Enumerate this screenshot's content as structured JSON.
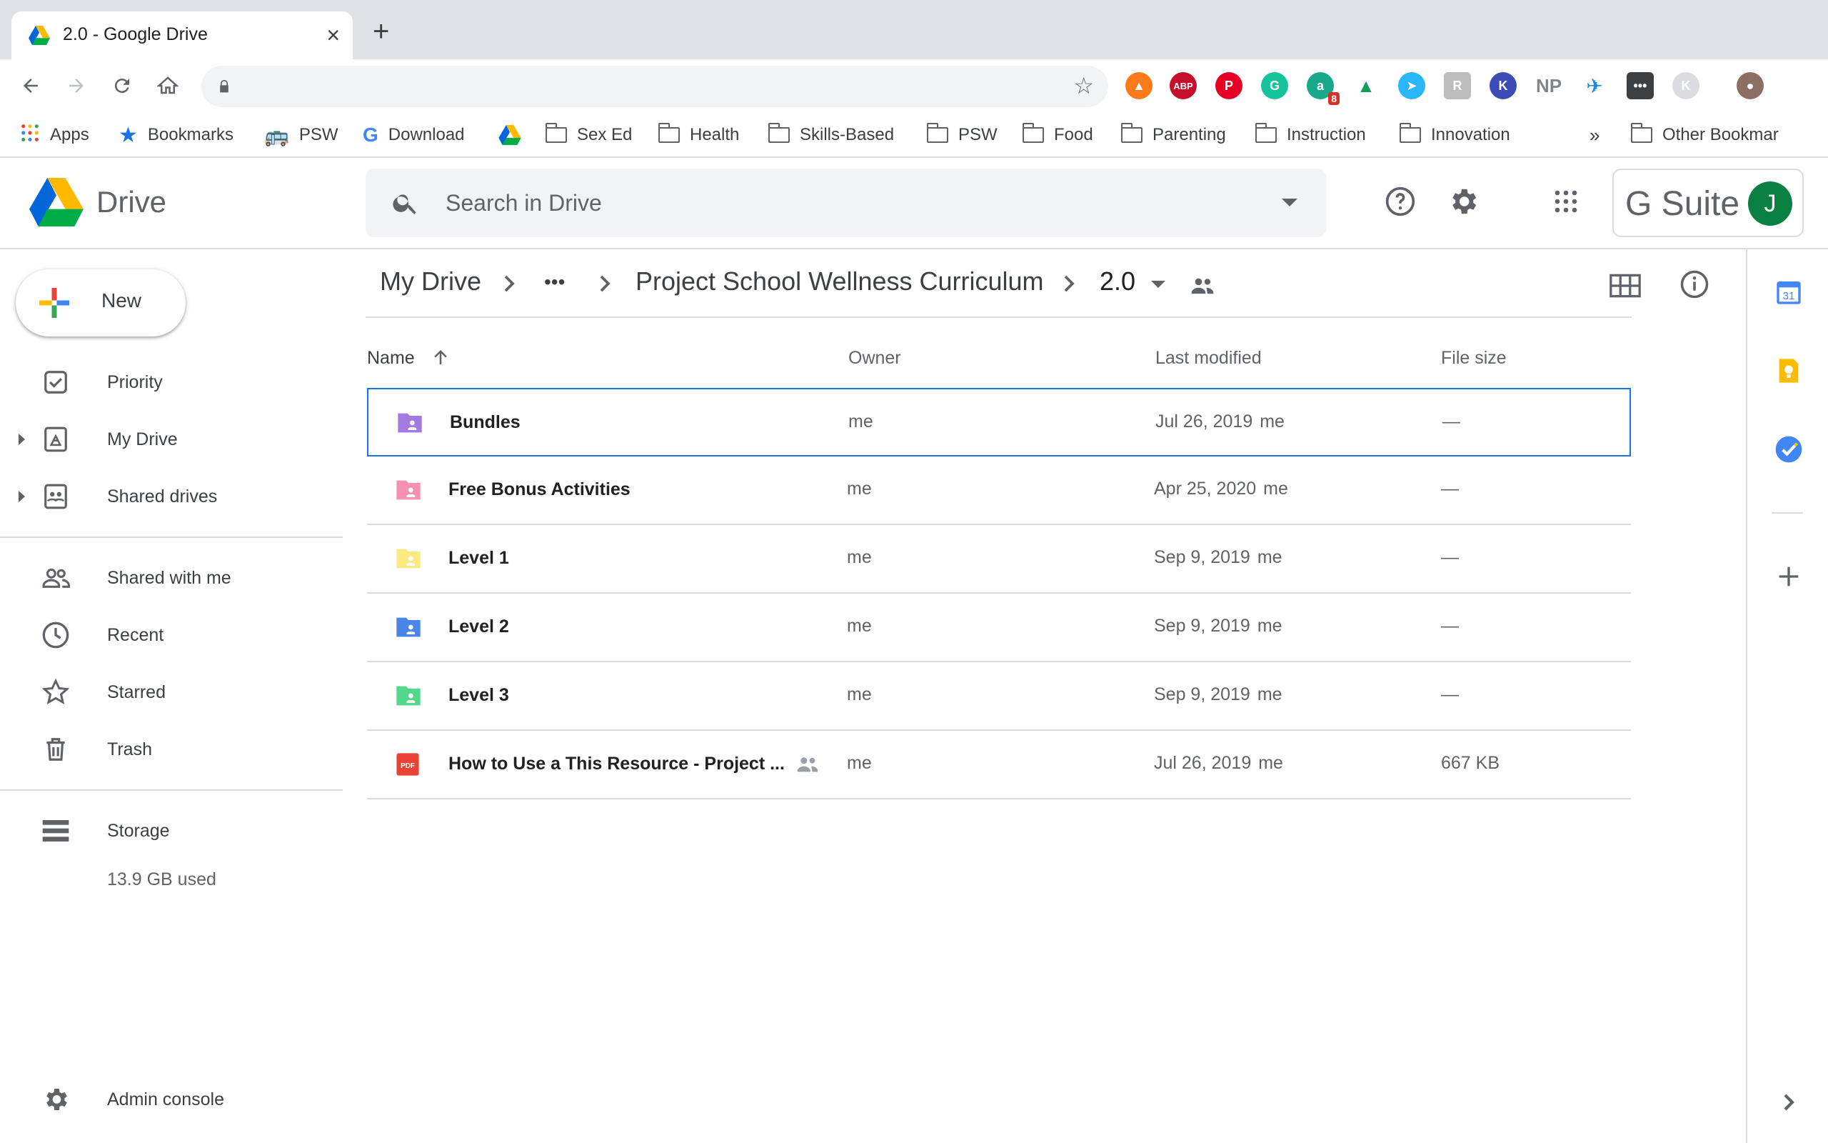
{
  "browser": {
    "tab_title": "2.0 - Google Drive",
    "close_glyph": "×",
    "new_tab_glyph": "+",
    "url": "",
    "extension_badge": "8",
    "extension_np": "NP"
  },
  "bookmarks": {
    "apps": "Apps",
    "items": [
      "Bookmarks",
      "PSW",
      "Download",
      "Sex Ed",
      "Health",
      "Skills-Based",
      "PSW",
      "Food",
      "Parenting",
      "Instruction",
      "Innovation"
    ],
    "overflow": "»",
    "other": "Other Bookmar"
  },
  "header": {
    "app_name": "Drive",
    "search_placeholder": "Search in Drive",
    "gsuite_label": "G Suite",
    "avatar_letter": "J"
  },
  "sidebar": {
    "new_label": "New",
    "items": [
      {
        "label": "Priority",
        "icon": "priority-icon"
      },
      {
        "label": "My Drive",
        "icon": "my-drive-icon"
      },
      {
        "label": "Shared drives",
        "icon": "shared-drives-icon"
      },
      {
        "label": "Shared with me",
        "icon": "people-icon"
      },
      {
        "label": "Recent",
        "icon": "clock-icon"
      },
      {
        "label": "Starred",
        "icon": "star-icon"
      },
      {
        "label": "Trash",
        "icon": "trash-icon"
      }
    ],
    "storage_label": "Storage",
    "storage_used": "13.9 GB used",
    "admin_label": "Admin console"
  },
  "breadcrumb": {
    "root": "My Drive",
    "ellipsis": "•••",
    "parent": "Project School Wellness Curriculum",
    "current": "2.0"
  },
  "columns": {
    "name": "Name",
    "owner": "Owner",
    "modified": "Last modified",
    "size": "File size"
  },
  "files": [
    {
      "name": "Bundles",
      "type": "shared-folder",
      "color": "#a479e2",
      "owner": "me",
      "modified": "Jul 26, 2019",
      "modified_by": "me",
      "size": "—",
      "selected": true
    },
    {
      "name": "Free Bonus Activities",
      "type": "shared-folder",
      "color": "#f691b3",
      "owner": "me",
      "modified": "Apr 25, 2020",
      "modified_by": "me",
      "size": "—"
    },
    {
      "name": "Level 1",
      "type": "shared-folder",
      "color": "#fbe983",
      "owner": "me",
      "modified": "Sep 9, 2019",
      "modified_by": "me",
      "size": "—"
    },
    {
      "name": "Level 2",
      "type": "shared-folder",
      "color": "#4986e7",
      "owner": "me",
      "modified": "Sep 9, 2019",
      "modified_by": "me",
      "size": "—"
    },
    {
      "name": "Level 3",
      "type": "shared-folder",
      "color": "#51d88a",
      "owner": "me",
      "modified": "Sep 9, 2019",
      "modified_by": "me",
      "size": "—"
    },
    {
      "name": "How to Use a This Resource - Project ...",
      "type": "pdf",
      "color": "#ea4335",
      "owner": "me",
      "modified": "Jul 26, 2019",
      "modified_by": "me",
      "size": "667 KB",
      "shared": true
    }
  ],
  "side_panel": {
    "calendar_day": "31"
  }
}
